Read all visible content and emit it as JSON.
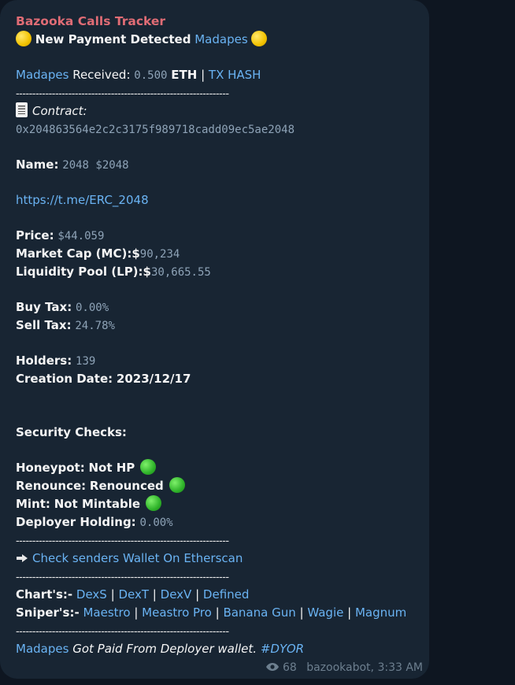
{
  "message": {
    "sender": "Bazooka Calls Tracker",
    "header_text": "New Payment Detected",
    "header_link": "Madapes",
    "received_link": "Madapes",
    "received_label": "Received:",
    "received_amount": "0.500",
    "received_unit": "ETH",
    "pipe": "|",
    "tx_hash_link": "TX HASH",
    "divider": "-----------------------------------------------------------------",
    "contract_label": "Contract:",
    "contract_address": "0x204863564e2c2c3175f989718cadd09ec5ae2048",
    "name_label": "Name:",
    "name_value": "2048 $2048",
    "telegram_link": "https://t.me/ERC_2048",
    "price_label": "Price:",
    "price_value": "$44.059",
    "mc_label": "Market Cap (MC):",
    "mc_currency": "$",
    "mc_value": "90,234",
    "lp_label": "Liquidity Pool (LP):",
    "lp_currency": "$",
    "lp_value": "30,665.55",
    "buy_tax_label": "Buy Tax:",
    "buy_tax_value": "0.00%",
    "sell_tax_label": "Sell Tax:",
    "sell_tax_value": "24.78%",
    "holders_label": "Holders:",
    "holders_value": "139",
    "creation_label": "Creation Date:",
    "creation_value": "2023/12/17",
    "security_header": "Security Checks:",
    "honeypot_label": "Honeypot:",
    "honeypot_value": "Not HP",
    "renounce_label": "Renounce:",
    "renounce_value": "Renounced",
    "mint_label": "Mint:",
    "mint_value": "Not Mintable",
    "deployer_label": "Deployer Holding:",
    "deployer_value": "0.00%",
    "etherscan_link": "Check senders Wallet On Etherscan",
    "charts_label": "Chart's:-",
    "charts_links": [
      "DexS",
      "DexT",
      "DexV",
      "Defined"
    ],
    "snipers_label": "Sniper's:-",
    "snipers_links": [
      "Maestro",
      "Meastro Pro",
      "Banana Gun",
      "Wagie",
      "Magnum"
    ],
    "footer_link": "Madapes",
    "footer_text": "Got Paid From Deployer wallet.",
    "footer_tag": "#DYOR",
    "views": "68",
    "author_time": "bazookabot, 3:33 AM"
  },
  "colors": {
    "background": "#0e1621",
    "bubble": "#182533",
    "sender": "#e06c75",
    "link": "#6ab3f3",
    "mono": "#8ea3b7",
    "meta": "#6d7f8f"
  },
  "icons": [
    "yellow-circle-emoji",
    "document-emoji",
    "arrow-emoji",
    "green-circle-emoji",
    "eye-icon"
  ]
}
